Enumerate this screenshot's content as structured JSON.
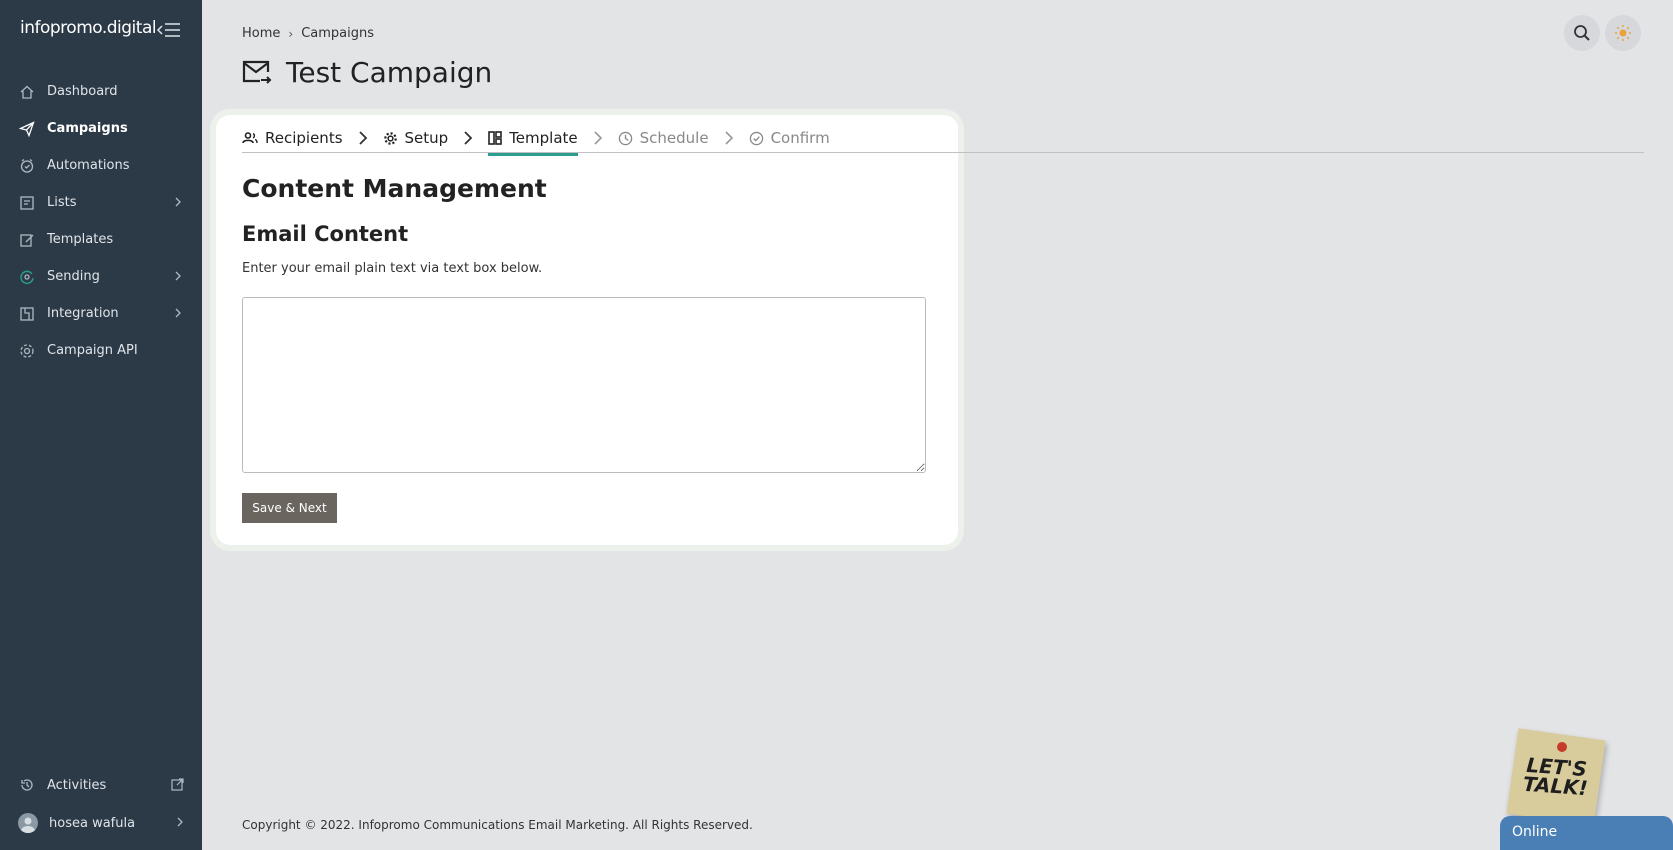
{
  "brand": {
    "logo_text": "infopromo.digital"
  },
  "sidebar": {
    "items": [
      {
        "label": "Dashboard",
        "icon": "home-icon"
      },
      {
        "label": "Campaigns",
        "icon": "send-icon"
      },
      {
        "label": "Automations",
        "icon": "automation-icon"
      },
      {
        "label": "Lists",
        "icon": "lists-icon",
        "has_submenu": true
      },
      {
        "label": "Templates",
        "icon": "templates-icon"
      },
      {
        "label": "Sending",
        "icon": "sending-icon",
        "has_submenu": true
      },
      {
        "label": "Integration",
        "icon": "integration-icon",
        "has_submenu": true
      },
      {
        "label": "Campaign API",
        "icon": "api-icon"
      }
    ],
    "active_item": "Campaigns",
    "activities_label": "Activities",
    "user_name": "hosea wafula"
  },
  "breadcrumb": {
    "home": "Home",
    "current": "Campaigns"
  },
  "page": {
    "title": "Test Campaign"
  },
  "steps": [
    {
      "label": "Recipients",
      "state": "done"
    },
    {
      "label": "Setup",
      "state": "done"
    },
    {
      "label": "Template",
      "state": "active"
    },
    {
      "label": "Schedule",
      "state": "disabled"
    },
    {
      "label": "Confirm",
      "state": "disabled"
    }
  ],
  "content": {
    "section_title": "Content Management",
    "sub_title": "Email Content",
    "hint": "Enter your email plain text via text box below.",
    "textarea_value": "",
    "save_label": "Save & Next"
  },
  "footer": {
    "copyright": "Copyright © 2022. Infopromo Communications Email Marketing. All Rights Reserved."
  },
  "widget": {
    "sticky_text": "LET'S TALK!",
    "chat_status": "Online"
  },
  "colors": {
    "sidebar_bg": "#2c3a47",
    "accent": "#2a9d8f",
    "button": "#6b6560",
    "chat": "#4a7fb5"
  }
}
